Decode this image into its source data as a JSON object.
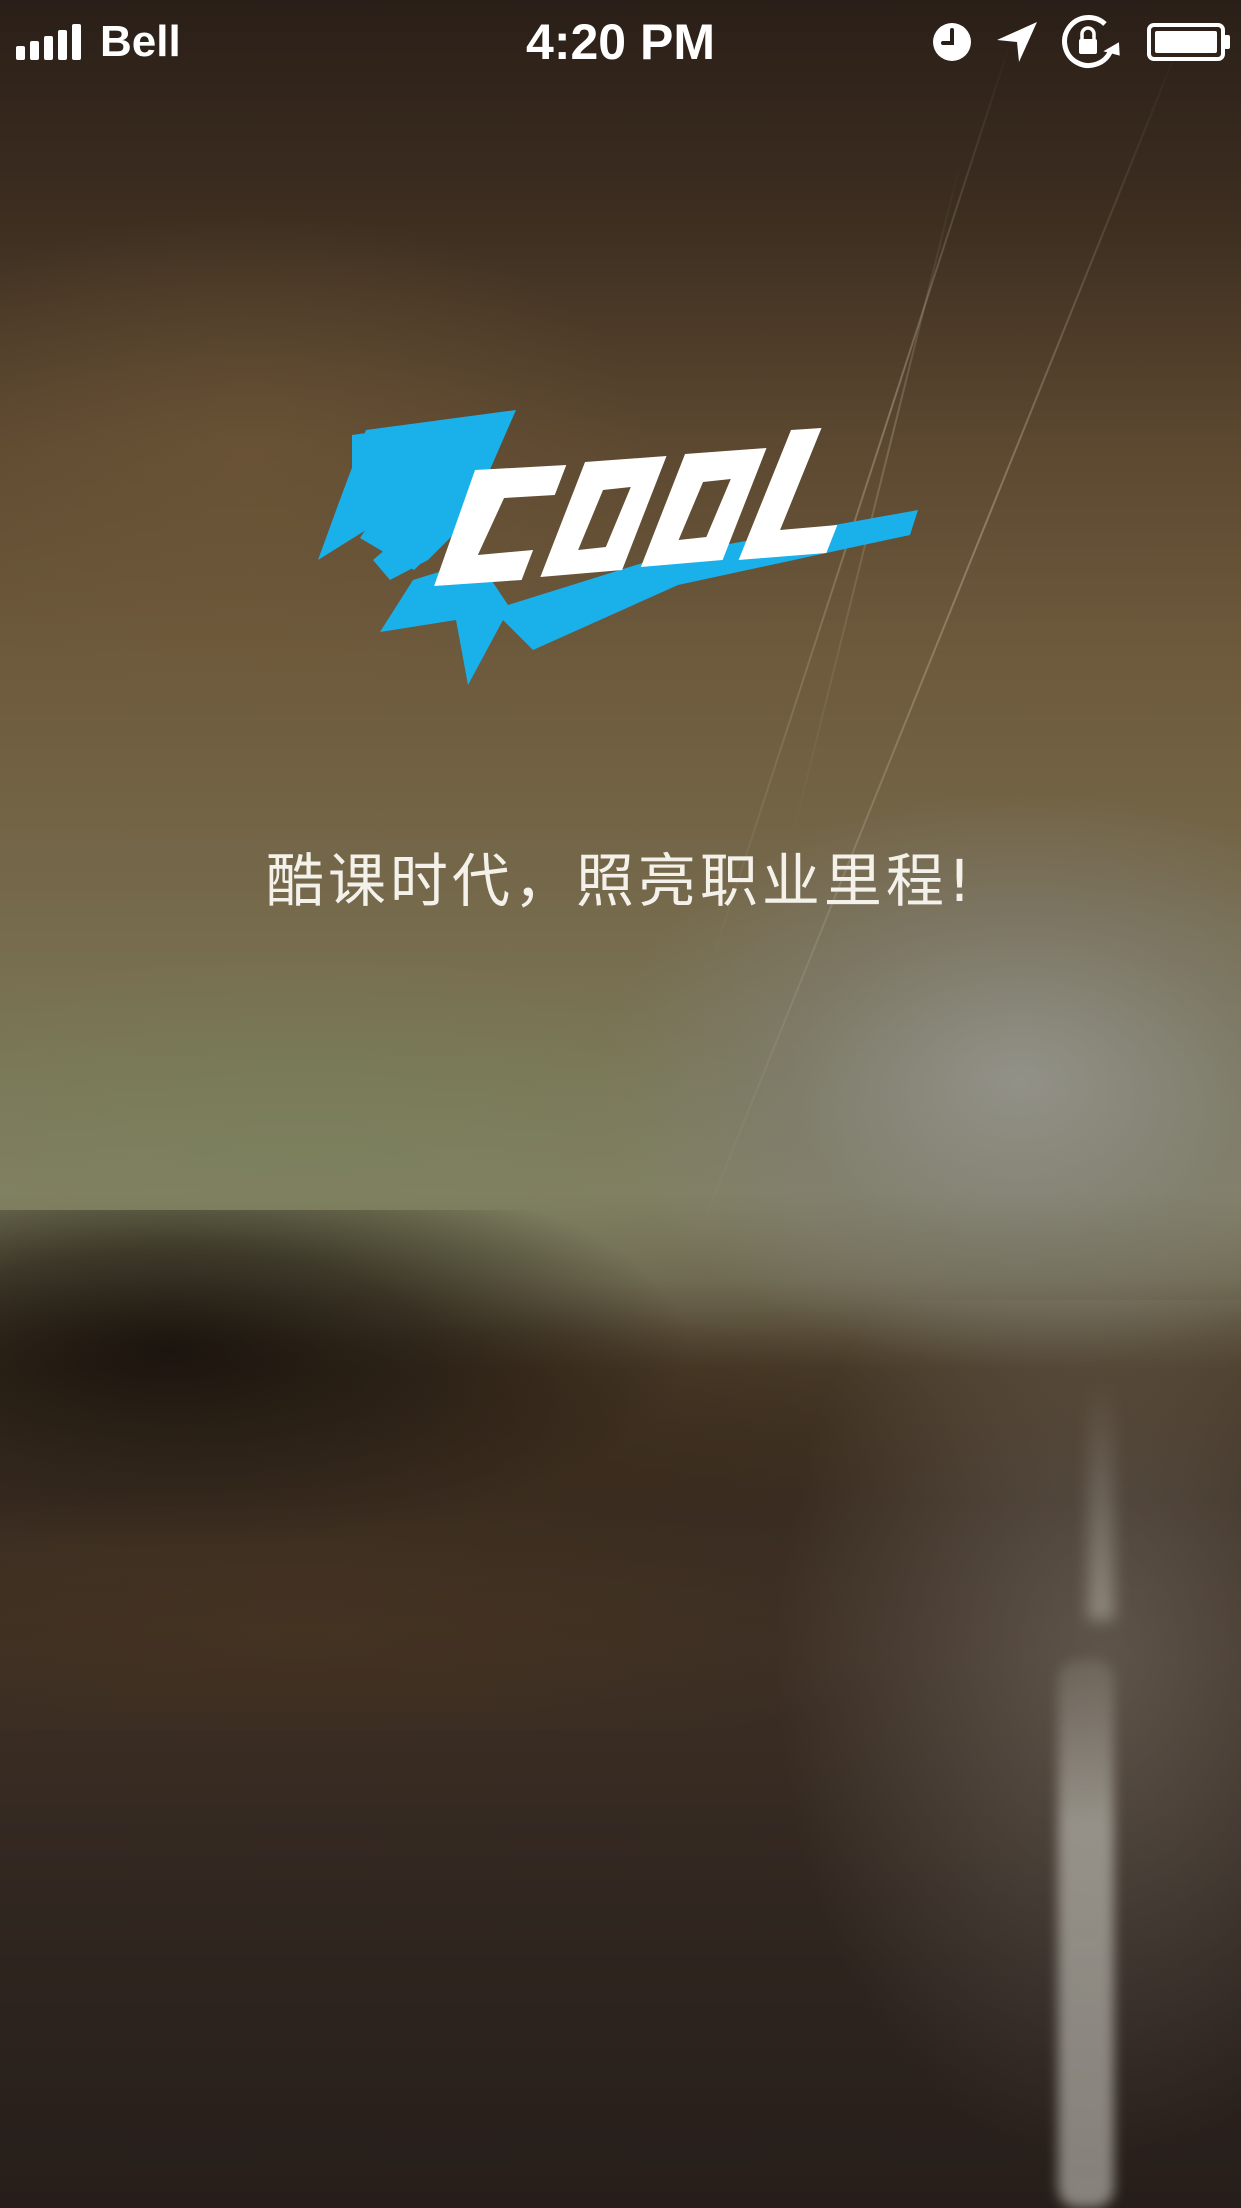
{
  "status_bar": {
    "carrier": "Bell",
    "time": "4:20 PM",
    "icons": [
      "signal-strength-icon",
      "alarm-clock-icon",
      "location-arrow-icon",
      "rotation-lock-icon",
      "battery-icon"
    ],
    "battery_level": 1.0
  },
  "splash": {
    "logo_text": "ZCOOL",
    "logo_colors": {
      "blue": "#1ab0ea",
      "white": "#ffffff"
    },
    "slogan": "酷课时代，照亮职业里程!"
  }
}
